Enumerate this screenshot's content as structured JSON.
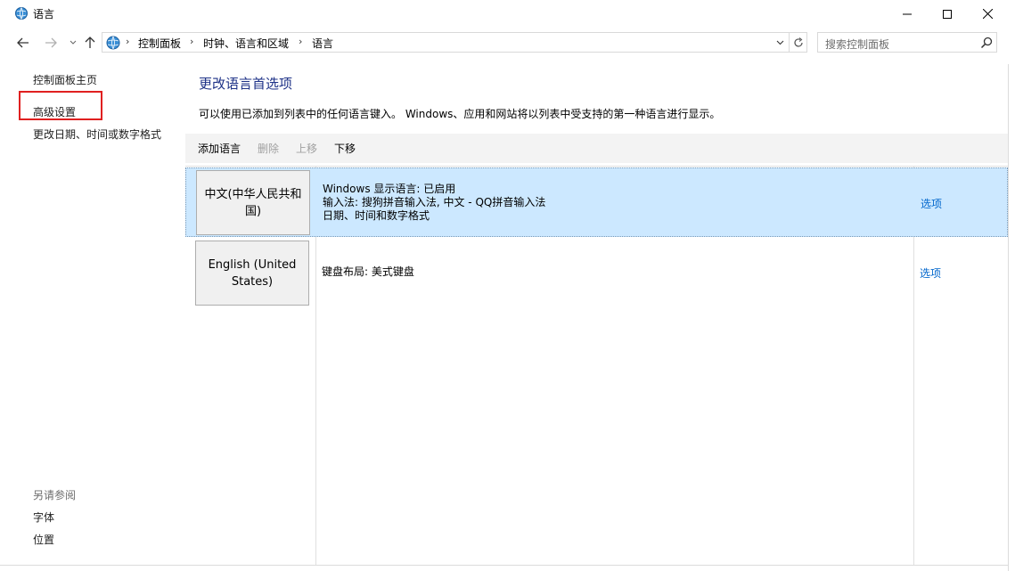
{
  "window": {
    "title": "语言",
    "icon": "control-panel-globe-icon"
  },
  "nav": {
    "breadcrumbs": [
      "控制面板",
      "时钟、语言和区域",
      "语言"
    ],
    "search_placeholder": "搜索控制面板"
  },
  "sidebar": {
    "links": [
      "控制面板主页",
      "高级设置",
      "更改日期、时间或数字格式"
    ],
    "highlighted": "高级设置",
    "see_also_title": "另请参阅",
    "see_also_links": [
      "字体",
      "位置"
    ]
  },
  "main": {
    "heading": "更改语言首选项",
    "description": "可以使用已添加到列表中的任何语言键入。 Windows、应用和网站将以列表中受支持的第一种语言进行显示。",
    "toolbar": {
      "add": "添加语言",
      "remove": "删除",
      "move_up": "上移",
      "move_down": "下移"
    },
    "languages": [
      {
        "name": "中文(中华人民共和国)",
        "details": [
          "Windows 显示语言: 已启用",
          "输入法: 搜狗拼音输入法, 中文 - QQ拼音输入法",
          "日期、时间和数字格式"
        ],
        "options_label": "选项",
        "selected": true
      },
      {
        "name": "English (United States)",
        "details": [
          "键盘布局: 美式键盘"
        ],
        "options_label": "选项",
        "selected": false
      }
    ]
  },
  "colors": {
    "accent": "#1e3287",
    "link": "#0066cc",
    "selection": "#cce8ff",
    "highlight_box": "#e02020"
  }
}
